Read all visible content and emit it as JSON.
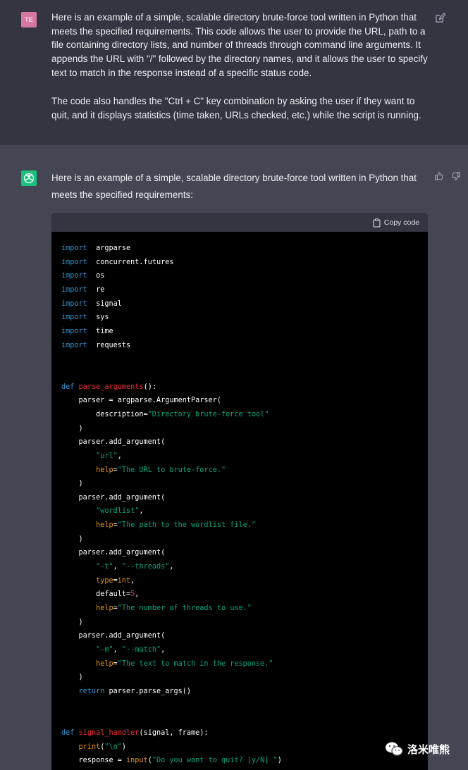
{
  "user_message": {
    "avatar": "TE",
    "paragraphs": [
      "Here is an example of a simple, scalable directory brute-force tool written in Python that meets the specified requirements. This code allows the user to provide the URL, path to a file containing directory lists, and number of threads through command line arguments. It appends the URL with \"/\" followed by the directory names, and it allows the user to specify text to match in the response instead of a specific status code.",
      "The code also handles the \"Ctrl + C\" key combination by asking the user if they want to quit, and it displays statistics (time taken, URLs checked, etc.) while the script is running."
    ],
    "edit_icon": "edit-icon"
  },
  "assistant_message": {
    "intro": "Here is an example of a simple, scalable directory brute-force tool written in Python that meets the specified requirements:",
    "thumbs_up_icon": "thumbs-up-icon",
    "thumbs_down_icon": "thumbs-down-icon"
  },
  "code_block": {
    "copy_label": "Copy code",
    "lines": [
      [
        [
          "kw",
          "import"
        ],
        [
          "",
          "  argparse"
        ]
      ],
      [
        [
          "kw",
          "import"
        ],
        [
          "",
          "  concurrent.futures"
        ]
      ],
      [
        [
          "kw",
          "import"
        ],
        [
          "",
          "  os"
        ]
      ],
      [
        [
          "kw",
          "import"
        ],
        [
          "",
          "  re"
        ]
      ],
      [
        [
          "kw",
          "import"
        ],
        [
          "",
          "  signal"
        ]
      ],
      [
        [
          "kw",
          "import"
        ],
        [
          "",
          "  sys"
        ]
      ],
      [
        [
          "kw",
          "import"
        ],
        [
          "",
          "  time"
        ]
      ],
      [
        [
          "kw",
          "import"
        ],
        [
          "",
          "  requests"
        ]
      ],
      [],
      [],
      [
        [
          "kw",
          "def"
        ],
        [
          "",
          " "
        ],
        [
          "fn",
          "parse_arguments"
        ],
        [
          "",
          "():"
        ]
      ],
      [
        [
          "",
          "    parser = argparse.ArgumentParser("
        ]
      ],
      [
        [
          "",
          "        description="
        ],
        [
          "str",
          "\"Directory brute-force tool\""
        ]
      ],
      [
        [
          "",
          "    )"
        ]
      ],
      [
        [
          "",
          "    parser.add_argument("
        ]
      ],
      [
        [
          "str",
          "        \"url\""
        ],
        [
          "",
          ","
        ]
      ],
      [
        [
          "",
          "        "
        ],
        [
          "bi",
          "help"
        ],
        [
          "",
          "="
        ],
        [
          "str",
          "\"The URL to brute-force.\""
        ]
      ],
      [
        [
          "",
          "    )"
        ]
      ],
      [
        [
          "",
          "    parser.add_argument("
        ]
      ],
      [
        [
          "str",
          "        \"wordlist\""
        ],
        [
          "",
          ","
        ]
      ],
      [
        [
          "",
          "        "
        ],
        [
          "bi",
          "help"
        ],
        [
          "",
          "="
        ],
        [
          "str",
          "\"The path to the wordlist file.\""
        ]
      ],
      [
        [
          "",
          "    )"
        ]
      ],
      [
        [
          "",
          "    parser.add_argument("
        ]
      ],
      [
        [
          "str",
          "        \"-t\""
        ],
        [
          "",
          ", "
        ],
        [
          "str",
          "\"--threads\""
        ],
        [
          "",
          ","
        ]
      ],
      [
        [
          "",
          "        "
        ],
        [
          "bi",
          "type"
        ],
        [
          "",
          "="
        ],
        [
          "bi",
          "int"
        ],
        [
          "",
          ","
        ]
      ],
      [
        [
          "",
          "        default="
        ],
        [
          "num",
          "5"
        ],
        [
          "",
          ","
        ]
      ],
      [
        [
          "",
          "        "
        ],
        [
          "bi",
          "help"
        ],
        [
          "",
          "="
        ],
        [
          "str",
          "\"The number of threads to use.\""
        ]
      ],
      [
        [
          "",
          "    )"
        ]
      ],
      [
        [
          "",
          "    parser.add_argument("
        ]
      ],
      [
        [
          "str",
          "        \"-m\""
        ],
        [
          "",
          ", "
        ],
        [
          "str",
          "\"--match\""
        ],
        [
          "",
          ","
        ]
      ],
      [
        [
          "",
          "        "
        ],
        [
          "bi",
          "help"
        ],
        [
          "",
          "="
        ],
        [
          "str",
          "\"The text to match in the response.\""
        ]
      ],
      [
        [
          "",
          "    )"
        ]
      ],
      [
        [
          "kw",
          "    return"
        ],
        [
          "",
          " parser.parse_args()"
        ]
      ],
      [],
      [],
      [
        [
          "kw",
          "def"
        ],
        [
          "",
          " "
        ],
        [
          "fn",
          "signal_handler"
        ],
        [
          "",
          "(signal, frame):"
        ]
      ],
      [
        [
          "bi",
          "    print"
        ],
        [
          "",
          "("
        ],
        [
          "str",
          "\"\\n\""
        ],
        [
          "",
          ")"
        ]
      ],
      [
        [
          "",
          "    response = "
        ],
        [
          "bi",
          "input"
        ],
        [
          "",
          "("
        ],
        [
          "str",
          "\"Do you want to quit? [y/N] \""
        ],
        [
          "",
          ")"
        ]
      ]
    ]
  },
  "watermark": {
    "text": "洛米唯熊",
    "icon": "wechat-icon"
  },
  "colors": {
    "user_bg": "#343541",
    "assistant_bg": "#444654",
    "gpt_avatar": "#19c37d",
    "user_avatar": "#d5779e"
  }
}
